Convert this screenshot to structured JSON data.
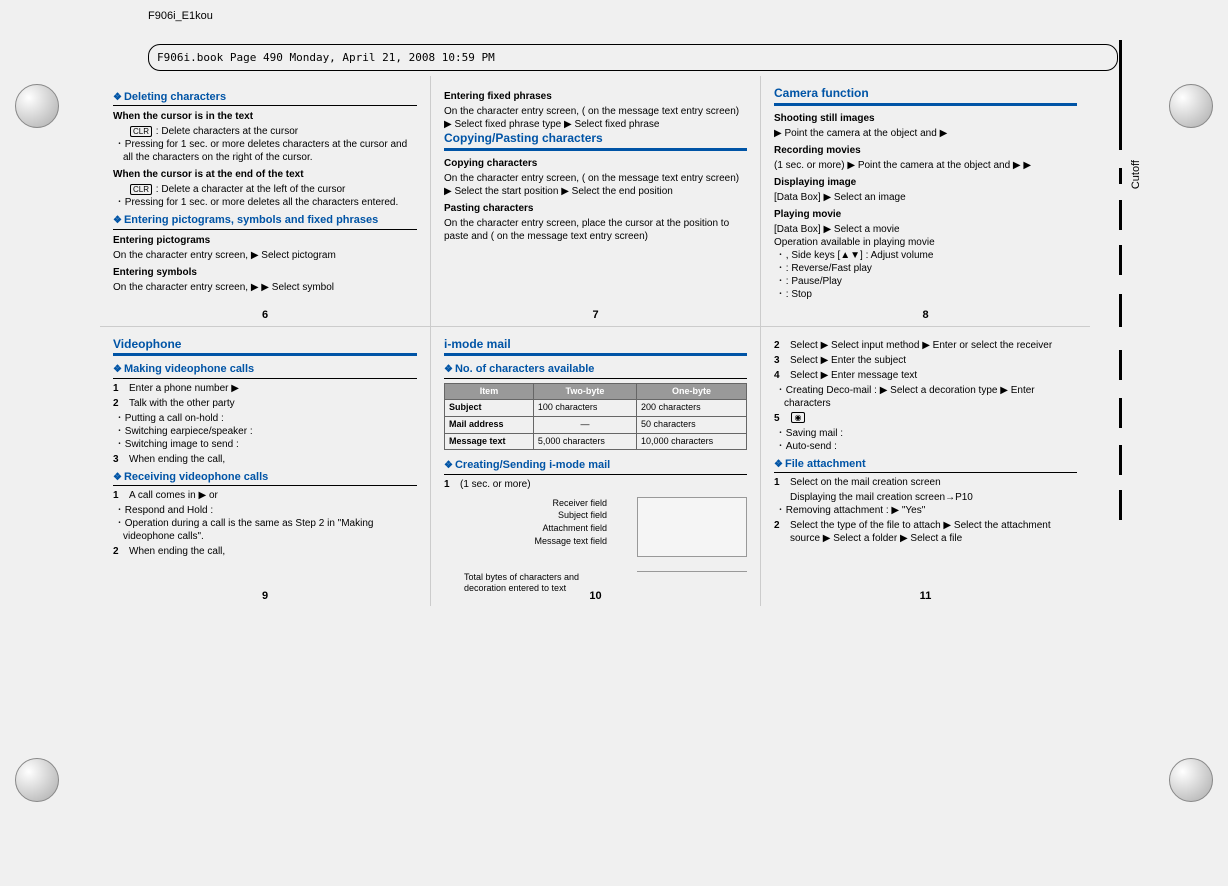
{
  "doc_header": "F906i_E1kou",
  "book_header": "F906i.book  Page 490  Monday, April 21, 2008  10:59 PM",
  "cutoff_label": "Cutoff",
  "pages": {
    "p6": {
      "num": "6",
      "s1_title": "Deleting characters",
      "s1_h1": "When the cursor is in the text",
      "s1_h1_line": " : Delete characters at the cursor",
      "s1_h1_b1": "Pressing for 1 sec. or more deletes characters at the cursor and all the characters on the right of the cursor.",
      "s1_h2": "When the cursor is at the end of the text",
      "s1_h2_line": " : Delete a character at the left of the cursor",
      "s1_h2_b1": "Pressing for 1 sec. or more deletes all the characters entered.",
      "s2_title": "Entering pictograms, symbols and fixed phrases",
      "s2_h1": "Entering pictograms",
      "s2_h1_line": "On the character entry screen,  ▶ Select pictogram",
      "s2_h2": "Entering symbols",
      "s2_h2_line": "On the character entry screen,  ▶  ▶ Select symbol"
    },
    "p7": {
      "num": "7",
      "s1_h1": "Entering fixed phrases",
      "s1_line1": "On the character entry screen,    (  on the message text entry screen) ▶ Select fixed phrase type ▶ Select fixed phrase",
      "s2_title": "Copying/Pasting characters",
      "s2_h1": "Copying characters",
      "s2_h1_line": "On the character entry screen,   (  on the message text entry screen) ▶ Select the start position ▶ Select the end position",
      "s2_h2": "Pasting characters",
      "s2_h2_line": "On the character entry screen, place the cursor at the position to paste and   ( on the message text entry screen)"
    },
    "p8": {
      "num": "8",
      "title": "Camera function",
      "h1": "Shooting still images",
      "h1_line": " ▶ Point the camera at the object and  ▶ ",
      "h2": "Recording movies",
      "h2_line": " (1 sec. or more) ▶ Point the camera at the object and  ▶  ▶ ",
      "h3": "Displaying image",
      "h3_line": " [Data Box]   ▶ Select an image",
      "h4": "Playing movie",
      "h4_line": " [Data Box]   ▶ Select a movie",
      "h4_line2": "Operation available in playing movie",
      "h4_b1": ", Side keys [▲▼] : Adjust volume",
      "h4_b2": " : Reverse/Fast play",
      "h4_b3": " : Pause/Play",
      "h4_b4": " : Stop"
    },
    "p9": {
      "num": "9",
      "title": "Videophone",
      "s1_title": "Making videophone calls",
      "s1_1": "Enter a phone number ▶ ",
      "s1_2": "Talk with the other party",
      "s1_2_b1": "Putting a call on-hold : ",
      "s1_2_b2": "Switching earpiece/speaker : ",
      "s1_2_b3": "Switching image to send : ",
      "s1_3": "When ending the call, ",
      "s2_title": "Receiving videophone calls",
      "s2_1": "A call comes in ▶  or ",
      "s2_1_b1": "Respond and Hold : ",
      "s2_1_b2": "Operation during a call is the same as Step 2 in \"Making videophone calls\".",
      "s2_2": "When ending the call, "
    },
    "p10": {
      "num": "10",
      "title": "i-mode mail",
      "s1_title": "No. of characters available",
      "table": {
        "h_item": "Item",
        "h_two": "Two-byte",
        "h_one": "One-byte",
        "r1": {
          "item": "Subject",
          "two": "100 characters",
          "one": "200 characters"
        },
        "r2": {
          "item": "Mail address",
          "two": "—",
          "one": "50 characters"
        },
        "r3": {
          "item": "Message text",
          "two": "5,000 characters",
          "one": "10,000 characters"
        }
      },
      "s2_title": "Creating/Sending i-mode mail",
      "s2_1": " (1 sec. or more)",
      "diagram": {
        "l1": "Receiver field",
        "l2": "Subject field",
        "l3": "Attachment field",
        "l4": "Message text field",
        "l5": "Total bytes of characters and decoration entered to text"
      }
    },
    "p11": {
      "num": "11",
      "s2": "Select  ▶ Select input method ▶ Enter or select the receiver",
      "s3": "Select  ▶ Enter the subject",
      "s4": "Select  ▶ Enter message text",
      "s4_b1": "Creating Deco-mail :  ▶ Select a decoration type ▶ Enter characters",
      "s5": "",
      "s5_b1": "Saving mail :  ",
      "s5_b2": "Auto-send :  ",
      "fa_title": "File attachment",
      "fa_1": "Select  on the mail creation screen",
      "fa_1b": "Displaying the mail creation screen→P10",
      "fa_1_b1": "Removing attachment :  ▶ \"Yes\"",
      "fa_2": "Select the type of the file to attach ▶ Select the attachment source ▶ Select a folder ▶ Select a file"
    }
  }
}
